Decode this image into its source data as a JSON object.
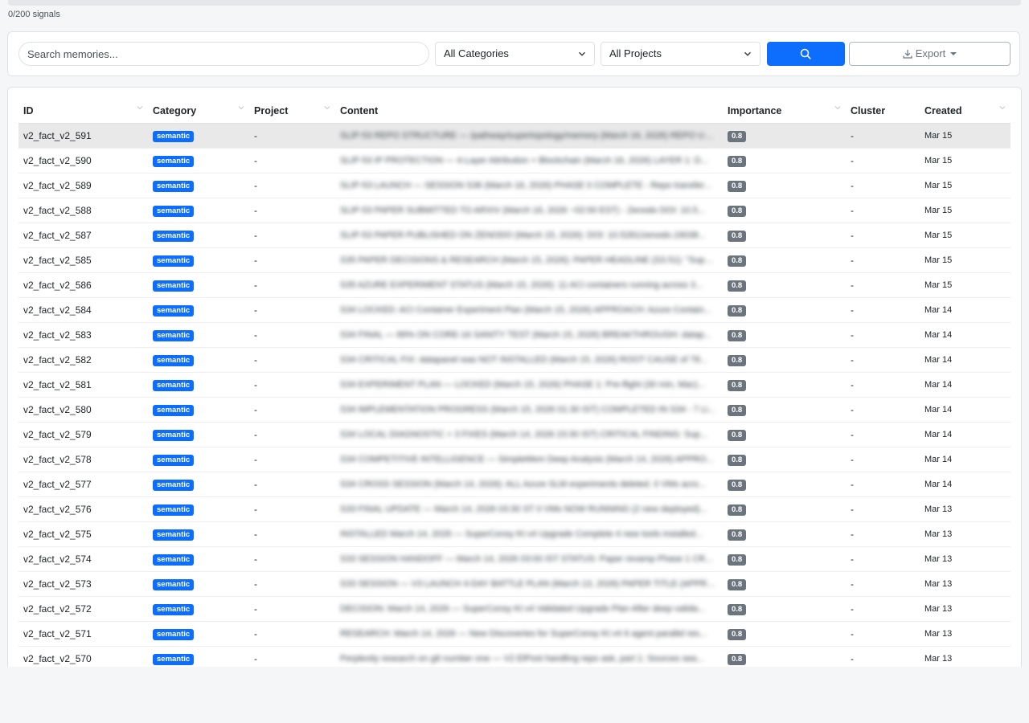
{
  "signals_text": "0/200 signals",
  "filters": {
    "search_placeholder": "Search memories...",
    "category_value": "All Categories",
    "project_value": "All Projects",
    "export_label": "Export"
  },
  "table": {
    "columns": [
      "ID",
      "Category",
      "Project",
      "Content",
      "Importance",
      "Cluster",
      "Created"
    ],
    "selected_row": 0,
    "rows": [
      {
        "id": "v2_fact_v2_591",
        "category": "semantic",
        "project": "-",
        "content": "SLIP-53 REPO STRUCTURE — /pathway/supertopology/memory (March 16, 2026) REPO URL: htt...",
        "importance": "0.8",
        "cluster": "-",
        "created": "Mar 15"
      },
      {
        "id": "v2_fact_v2_590",
        "category": "semantic",
        "project": "-",
        "content": "SLIP-53 IP PROTECTION — 4-Layer Attribution + Blockchain (March 16, 2026) LAYER 1: D...",
        "importance": "0.8",
        "cluster": "-",
        "created": "Mar 15"
      },
      {
        "id": "v2_fact_v2_589",
        "category": "semantic",
        "project": "-",
        "content": "SLIP-53 LAUNCH — SESSION S36 (March 16, 2026) PHASE 0 COMPLETE - Repo transfer...",
        "importance": "0.8",
        "cluster": "-",
        "created": "Mar 15"
      },
      {
        "id": "v2_fact_v2_588",
        "category": "semantic",
        "project": "-",
        "content": "SLIP-53 PAPER SUBMITTED TO ARXIV (March 16, 2026 ~02:00 EST) - Zenodo DOI: 10.5...",
        "importance": "0.8",
        "cluster": "-",
        "created": "Mar 15"
      },
      {
        "id": "v2_fact_v2_587",
        "category": "semantic",
        "project": "-",
        "content": "SLIP-53 PAPER PUBLISHED ON ZENODO (March 15, 2026): DOI: 10.5281/zenodo.19038...",
        "importance": "0.8",
        "cluster": "-",
        "created": "Mar 15"
      },
      {
        "id": "v2_fact_v2_585",
        "category": "semantic",
        "project": "-",
        "content": "S35 PAPER DECISIONS & RESEARCH (March 15, 2026): PAPER HEADLINE (S3.51): \"Super...",
        "importance": "0.8",
        "cluster": "-",
        "created": "Mar 15"
      },
      {
        "id": "v2_fact_v2_586",
        "category": "semantic",
        "project": "-",
        "content": "S35 AZURE EXPERIMENT STATUS (March 15, 2026): 11 ACI containers running across 3...",
        "importance": "0.8",
        "cluster": "-",
        "created": "Mar 15"
      },
      {
        "id": "v2_fact_v2_584",
        "category": "semantic",
        "project": "-",
        "content": "S34 LOCKED: ACI Container Experiment Plan (March 15, 2026) APPROACH: Azure Contain...",
        "importance": "0.8",
        "cluster": "-",
        "created": "Mar 14"
      },
      {
        "id": "v2_fact_v2_583",
        "category": "semantic",
        "project": "-",
        "content": "S34 FINAL — 89% ON CORE-16 SANITY TEST (March 15, 2026) BREAKTHROUGH: datap...",
        "importance": "0.8",
        "cluster": "-",
        "created": "Mar 14"
      },
      {
        "id": "v2_fact_v2_582",
        "category": "semantic",
        "project": "-",
        "content": "S34 CRITICAL FIX: datapanel was NOT INSTALLED (March 15, 2026) ROOT CAUSE of 78...",
        "importance": "0.8",
        "cluster": "-",
        "created": "Mar 14"
      },
      {
        "id": "v2_fact_v2_581",
        "category": "semantic",
        "project": "-",
        "content": "S34 EXPERIMENT PLAN — LOCKED (March 15, 2026) PHASE 1: Pre-flight (30 min, Mac)...",
        "importance": "0.8",
        "cluster": "-",
        "created": "Mar 14"
      },
      {
        "id": "v2_fact_v2_580",
        "category": "semantic",
        "project": "-",
        "content": "S34 IMPLEMENTATION PROGRESS (March 15, 2026 01:30 IST) COMPLETED IN S34 - 7 Li...",
        "importance": "0.8",
        "cluster": "-",
        "created": "Mar 14"
      },
      {
        "id": "v2_fact_v2_579",
        "category": "semantic",
        "project": "-",
        "content": "S34 LOCAL DIAGNOSTIC + 3 FIXES (March 14, 2026 23:30 IST) CRITICAL FINDING: Sup...",
        "importance": "0.8",
        "cluster": "-",
        "created": "Mar 14"
      },
      {
        "id": "v2_fact_v2_578",
        "category": "semantic",
        "project": "-",
        "content": "S34 COMPETITIVE INTELLIGENCE — SimpleMem Deep Analysis (March 14, 2026) APPRO...",
        "importance": "0.8",
        "cluster": "-",
        "created": "Mar 14"
      },
      {
        "id": "v2_fact_v2_577",
        "category": "semantic",
        "project": "-",
        "content": "S34 CROSS SESSION (March 14, 2026): ALL Azure SLM experiments deleted. 0 VMs acro...",
        "importance": "0.8",
        "cluster": "-",
        "created": "Mar 14"
      },
      {
        "id": "v2_fact_v2_576",
        "category": "semantic",
        "project": "-",
        "content": "S33 FINAL UPDATE — March 14, 2026 03:30 ST 0 VMs NOW RUNNING (2 new deployed)...",
        "importance": "0.8",
        "cluster": "-",
        "created": "Mar 13"
      },
      {
        "id": "v2_fact_v2_575",
        "category": "semantic",
        "project": "-",
        "content": "INSTALLED March 14, 2026 — SuperConsy Kt v4 Upgrade Complete 4 new tools installed...",
        "importance": "0.8",
        "cluster": "-",
        "created": "Mar 13"
      },
      {
        "id": "v2_fact_v2_574",
        "category": "semantic",
        "project": "-",
        "content": "S33 SESSION HANDOFF — March 14, 2026 03:00 IST STATUS: Paper revamp Phase 1 CR...",
        "importance": "0.8",
        "cluster": "-",
        "created": "Mar 13"
      },
      {
        "id": "v2_fact_v2_573",
        "category": "semantic",
        "project": "-",
        "content": "S33 SESSION — V3 LAUNCH 4-DAY BATTLE PLAN (March 13, 2026) PAPER TITLE (APPRO...",
        "importance": "0.8",
        "cluster": "-",
        "created": "Mar 13"
      },
      {
        "id": "v2_fact_v2_572",
        "category": "semantic",
        "project": "-",
        "content": "DECISION: March 14, 2026 — SuperConsy Kt v4 Validated Upgrade Plan After deep valida...",
        "importance": "0.8",
        "cluster": "-",
        "created": "Mar 13"
      },
      {
        "id": "v2_fact_v2_571",
        "category": "semantic",
        "project": "-",
        "content": "RESEARCH: March 14, 2026 — New Discoveries for SuperConsy Kt v4 6 agent parallel res...",
        "importance": "0.8",
        "cluster": "-",
        "created": "Mar 13"
      },
      {
        "id": "v2_fact_v2_570",
        "category": "semantic",
        "project": "-",
        "content": "Perplexity research on g8 number one — V2 ElPost handling repo ask, part 1: Sources sea...",
        "importance": "0.8",
        "cluster": "-",
        "created": "Mar 13"
      }
    ]
  }
}
